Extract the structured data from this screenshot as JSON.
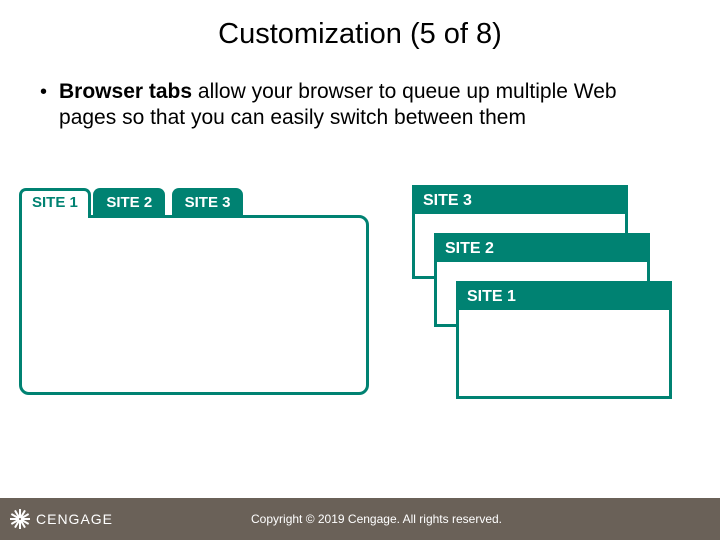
{
  "title": "Customization (5 of 8)",
  "bullet": {
    "lead_bold": "Browser tabs",
    "rest": " allow your browser to queue up multiple Web pages so that you can easily switch between them"
  },
  "tabs": {
    "site1": "SITE 1",
    "site2": "SITE 2",
    "site3": "SITE 3"
  },
  "stack": {
    "site1": "SITE 1",
    "site2": "SITE 2",
    "site3": "SITE 3"
  },
  "footer": {
    "brand": "CENGAGE",
    "copyright": "Copyright © 2019 Cengage. All rights reserved."
  },
  "colors": {
    "teal": "#008272",
    "footer": "#6a6158"
  }
}
